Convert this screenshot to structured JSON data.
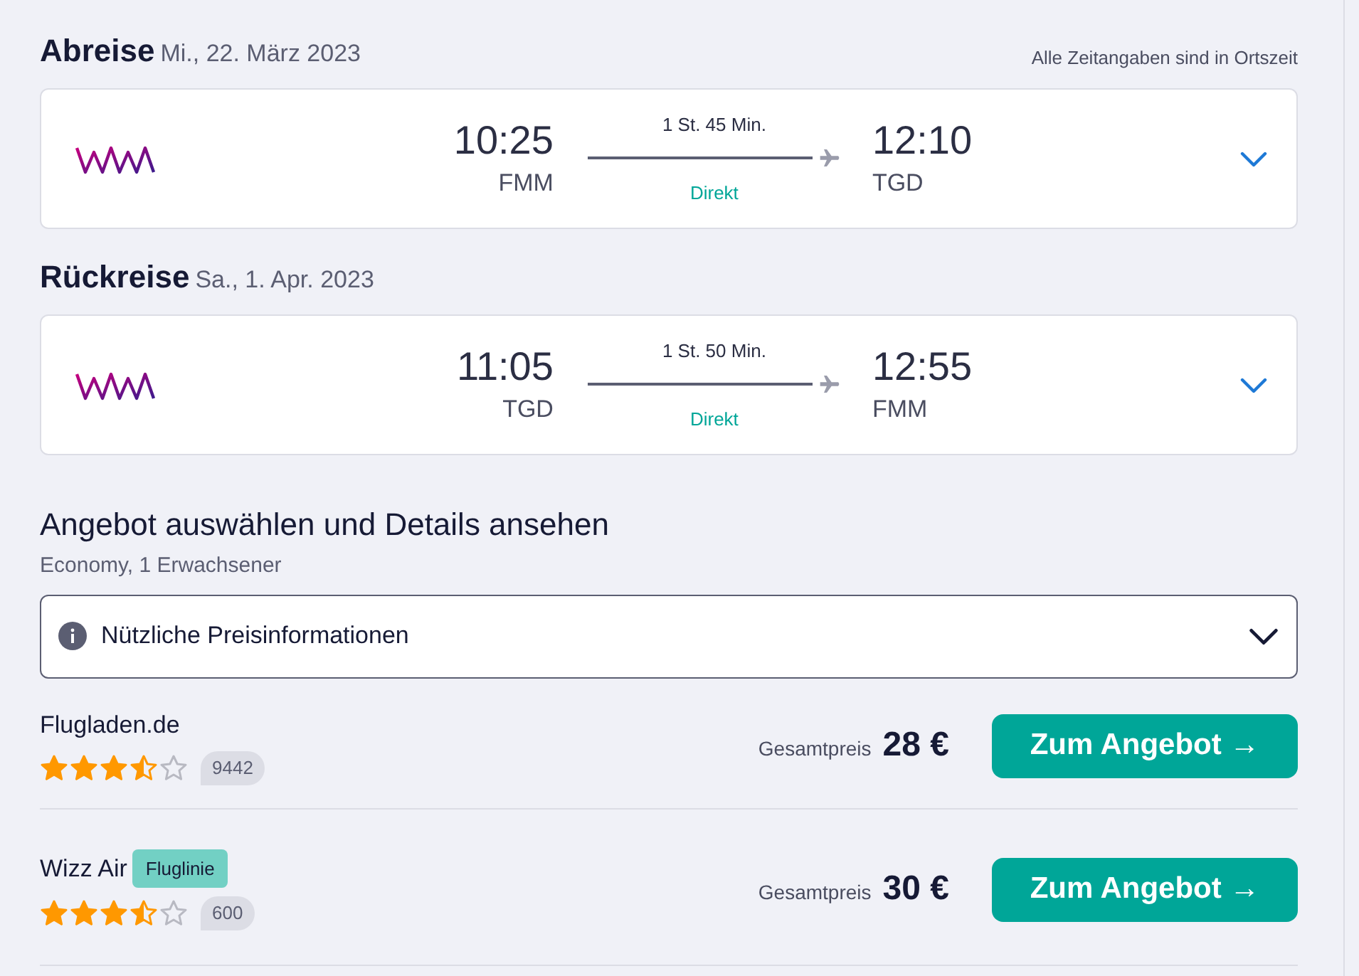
{
  "legs": [
    {
      "title": "Abreise",
      "date": "Mi., 22. März 2023",
      "note": "Alle Zeitangaben sind in Ortszeit",
      "depart_time": "10:25",
      "depart_airport": "FMM",
      "duration": "1 St. 45 Min.",
      "stops": "Direkt",
      "arrive_time": "12:10",
      "arrive_airport": "TGD",
      "expanded": false
    },
    {
      "title": "Rückreise",
      "date": "Sa., 1. Apr. 2023",
      "depart_time": "11:05",
      "depart_airport": "TGD",
      "duration": "1 St. 50 Min.",
      "stops": "Direkt",
      "arrive_time": "12:55",
      "arrive_airport": "FMM",
      "expanded": false
    }
  ],
  "offers_section": {
    "title": "Angebot auswählen und Details ansehen",
    "subtitle": "Economy, 1 Erwachsener",
    "info_dropdown": {
      "label": "Nützliche Preisinformationen",
      "expanded": false
    }
  },
  "offers": [
    {
      "provider": "Flugladen.de",
      "stars": 3.5,
      "review_count": "9442",
      "price_label": "Gesamtpreis",
      "price": "28 €",
      "button": "Zum Angebot →"
    },
    {
      "provider": "Wizz Air",
      "badge": "Fluglinie",
      "stars": 3.5,
      "review_count": "600",
      "price_label": "Gesamtpreis",
      "price": "30 €",
      "button": "Zum Angebot →"
    }
  ]
}
